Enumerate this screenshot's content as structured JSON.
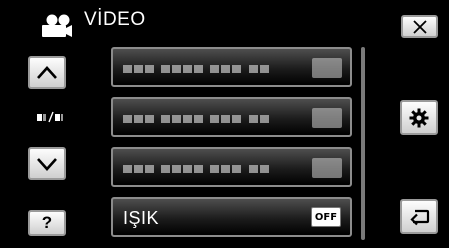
{
  "header": {
    "title": "VİDEO"
  },
  "menu": {
    "rows": [
      {
        "label": "",
        "value": ""
      },
      {
        "label": "",
        "value": ""
      },
      {
        "label": "",
        "value": ""
      },
      {
        "label": "IŞIK",
        "value": "OFF"
      }
    ]
  },
  "buttons": {
    "close": {
      "icon": "close-icon"
    },
    "scroll_up": {
      "icon": "chevron-up-icon"
    },
    "scroll_down": {
      "icon": "chevron-down-icon"
    },
    "help": {
      "label": "?"
    },
    "settings": {
      "icon": "gear-icon"
    },
    "back": {
      "icon": "return-arrow-icon"
    }
  },
  "page_indicator": {
    "icon": "page-indicator-icon"
  },
  "colors": {
    "background": "#000000",
    "button": "#e8e8e8",
    "row_border": "#8c8c8c"
  }
}
